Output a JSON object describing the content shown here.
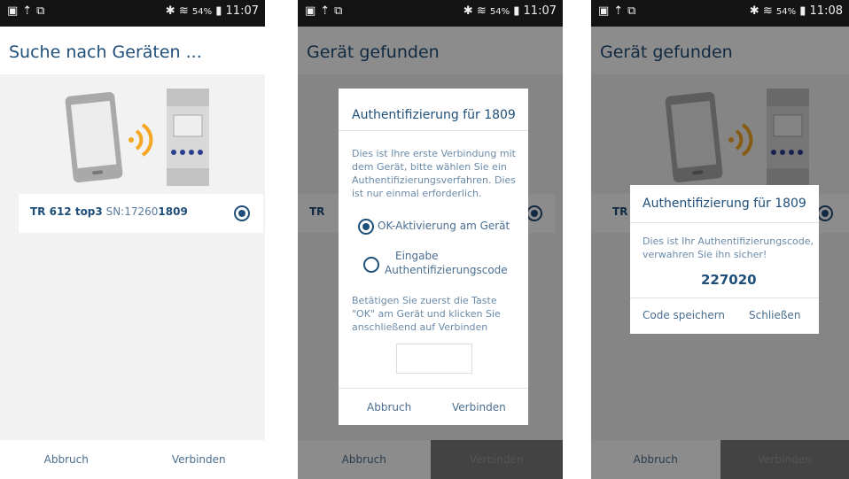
{
  "status_bar": {
    "left_icons": [
      "image-icon",
      "upload-icon",
      "screen-icon"
    ],
    "bluetooth": "✱",
    "wifi": "≋",
    "battery_text": "54%",
    "screen1_time": "11:07",
    "screen2_time": "11:07",
    "screen3_time": "11:08"
  },
  "screen1": {
    "title": "Suche nach Geräten ...",
    "device": {
      "model": "TR 612 top3",
      "sn_label": "SN:",
      "sn_prefix": "17260",
      "sn_bold": "1809"
    },
    "buttons": {
      "cancel": "Abbruch",
      "connect": "Verbinden"
    }
  },
  "screen2": {
    "title": "Gerät gefunden",
    "row_prefix": "TR",
    "dialog": {
      "title": "Authentifizierung für 1809",
      "intro": "Dies ist Ihre erste Verbindung mit dem Gerät, bitte wählen Sie ein Authentifizierungsverfahren. Dies ist nur einmal erforderlich.",
      "option1": "OK-Aktivierung am Gerät",
      "option2_line1": "Eingabe",
      "option2_line2": "Authentifizierungscode",
      "instruction": "Betätigen Sie zuerst die Taste \"OK\" am Gerät und klicken Sie anschließend auf Verbinden",
      "cancel": "Abbruch",
      "connect": "Verbinden"
    },
    "buttons": {
      "cancel": "Abbruch",
      "connect": "Verbinden"
    }
  },
  "screen3": {
    "title": "Gerät gefunden",
    "row_prefix": "TR",
    "dialog": {
      "title": "Authentifizierung für 1809",
      "text": "Dies ist Ihr Authentifizierungscode, verwahren Sie ihn sicher!",
      "code": "227020",
      "save": "Code speichern",
      "close": "Schließen"
    },
    "buttons": {
      "cancel": "Abbruch",
      "connect": "Verbinden"
    }
  },
  "colors": {
    "brand": "#1f4e79",
    "signal": "#f5a623",
    "overlay": "#000000"
  }
}
